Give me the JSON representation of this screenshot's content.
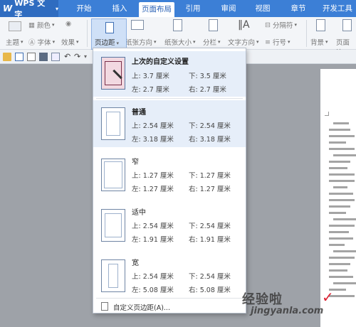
{
  "app": {
    "logo_letter": "W",
    "title": "WPS 文字",
    "arrow": "▾"
  },
  "tabs": [
    {
      "label": "开始"
    },
    {
      "label": "插入"
    },
    {
      "label": "页面布局"
    },
    {
      "label": "引用"
    },
    {
      "label": "审阅"
    },
    {
      "label": "视图"
    },
    {
      "label": "章节"
    },
    {
      "label": "开发工具"
    }
  ],
  "ribbon": {
    "color": "颜色",
    "font": "字体",
    "effect": "效果",
    "theme": "主题",
    "page_margin": "页边距",
    "paper_direction": "纸张方向",
    "paper_size": "纸张大小",
    "columns": "分栏",
    "text_direction": "文字方向",
    "separator": "分隔符",
    "line_number": "行号",
    "background": "背景",
    "page_border": "页面边"
  },
  "margin_menu": {
    "options": [
      {
        "title": "上次的自定义设置",
        "top": "上: 3.7 厘米",
        "bottom": "下: 3.5 厘米",
        "left": "左: 2.7 厘米",
        "right": "右: 2.7 厘米"
      },
      {
        "title": "普通",
        "top": "上: 2.54 厘米",
        "bottom": "下: 2.54 厘米",
        "left": "左: 3.18 厘米",
        "right": "右: 3.18 厘米"
      },
      {
        "title": "窄",
        "top": "上: 1.27 厘米",
        "bottom": "下: 1.27 厘米",
        "left": "左: 1.27 厘米",
        "right": "右: 1.27 厘米"
      },
      {
        "title": "适中",
        "top": "上: 2.54 厘米",
        "bottom": "下: 2.54 厘米",
        "left": "左: 1.91 厘米",
        "right": "右: 1.91 厘米"
      },
      {
        "title": "宽",
        "top": "上: 2.54 厘米",
        "bottom": "下: 2.54 厘米",
        "left": "左: 5.08 厘米",
        "right": "右: 5.08 厘米"
      }
    ],
    "custom_label": "自定义页边距(A)..."
  },
  "watermark": {
    "line1": "经验啦",
    "line2": "jingyanla.com",
    "check": "✓"
  },
  "colors": {
    "tab_bar": "#3c7fd6",
    "highlight": "#e6eef9",
    "pressed": "#cfe0f7"
  }
}
